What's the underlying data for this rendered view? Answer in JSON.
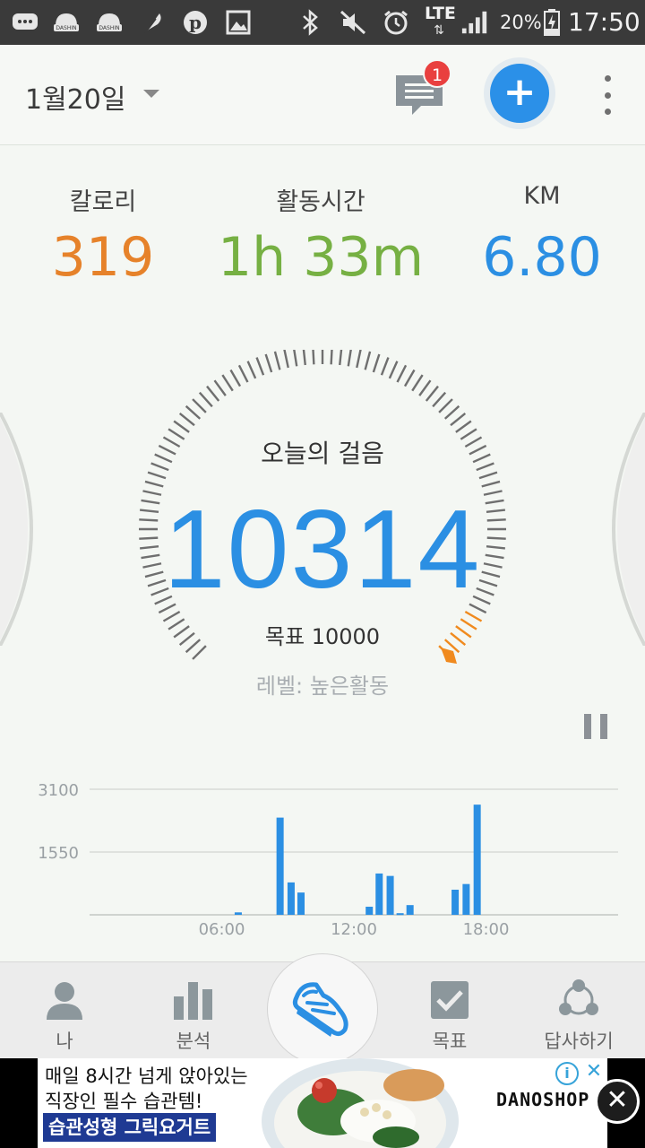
{
  "status_bar": {
    "left_icons": [
      "message-icon",
      "dashin-icon",
      "dashin-icon",
      "feather-icon",
      "pinterest-icon",
      "gallery-icon"
    ],
    "right_icons": [
      "bluetooth-icon",
      "mute-icon",
      "alarm-icon"
    ],
    "network": "LTE",
    "battery": "20%",
    "time": "17:50"
  },
  "header": {
    "date": "1월20일",
    "message_badge": "1",
    "add_icon": "+"
  },
  "stats": {
    "calories_label": "칼로리",
    "calories_value": "319",
    "active_label": "활동시간",
    "active_value": "1h 33m",
    "distance_label": "KM",
    "distance_value": "6.80"
  },
  "colors": {
    "calories": "#e6822a",
    "active": "#76b043",
    "distance": "#2b8fe3",
    "steps": "#2b8fe3",
    "goal_marker": "#f08a1e",
    "bar": "#2b8fe3"
  },
  "steps": {
    "title": "오늘의 걸음",
    "count": "10314",
    "goal": "목표 10000",
    "level": "레벨: 높은활동",
    "progress": 1.0
  },
  "chart_data": {
    "type": "bar",
    "ylim": [
      0,
      3100
    ],
    "yticks": [
      "3100",
      "1550"
    ],
    "ytick_values": [
      3100,
      1550
    ],
    "xticks": [
      "06:00",
      "12:00",
      "18:00"
    ],
    "xtick_positions": [
      6,
      12,
      18
    ],
    "x": [
      6.75,
      8.65,
      9.15,
      9.6,
      12.7,
      13.15,
      13.65,
      14.1,
      14.55,
      16.6,
      17.1,
      17.6
    ],
    "values": [
      60,
      2400,
      800,
      550,
      200,
      1020,
      960,
      40,
      240,
      620,
      760,
      2720
    ]
  },
  "bottom_nav": {
    "me": "나",
    "analysis": "분석",
    "goal": "목표",
    "share": "답사하기"
  },
  "ad": {
    "line1": "매일 8시간 넘게 앉아있는",
    "line2": "직장인 필수 습관템!",
    "cta": "습관성형 그릭요거트",
    "brand": "DANOSHOP",
    "info": "i",
    "dismiss": "✕",
    "close": "✕"
  }
}
